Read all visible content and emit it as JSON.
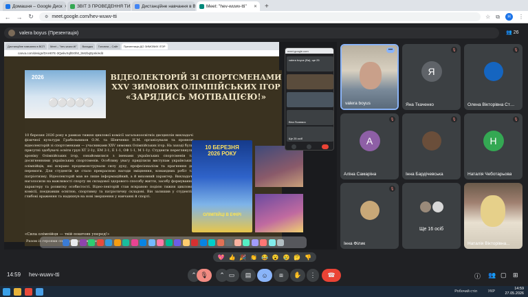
{
  "browser": {
    "tabs": [
      {
        "label": "Домашня – Google Диск",
        "color": "#1a73e8",
        "active": false
      },
      {
        "label": "ЗВІТ З ПРОВЕДЕННЯ ТИЖНЯ",
        "color": "#34a853",
        "active": false
      },
      {
        "label": "Дистанційне навчання в ВСП",
        "color": "#4285f4",
        "active": false
      },
      {
        "label": "Meet: \"hev-wuwv-tti\"",
        "color": "#00897b",
        "active": true
      }
    ],
    "new_tab": "+",
    "url": "meet.google.com/hev-wuwv-tti",
    "profile_letter": "Н"
  },
  "presenter": {
    "name": "valera boyus (Презентація)",
    "people_count": "26"
  },
  "shared_screen": {
    "inner_tabs": [
      "Chrome",
      "Файл",
      "Правка",
      "Вид",
      "Історія",
      "Закладки",
      "Профілі",
      "Вкладка",
      "Вікно",
      "Довідка"
    ],
    "inner_browser_tabs": [
      "Дистанційне навчання в ВСП",
      "Meet – \"hev-wuwv-tti\"",
      "Вкладка",
      "Головна – Сайт",
      "Презентація ДО ЗИМОВИХ ІГОР"
    ],
    "inner_url": "canva.com/design/DAHI0Tc-3QwkvXqfEI0h0_bMzbqDpnk/edit",
    "slide": {
      "badge_year": "2026",
      "rings": "⚪⚪⚪⚪⚪",
      "title_l1": "ВІДЕОЛЕКТОРІЙ ЗІ СПОРТСМЕНАМИ",
      "title_l2": "XXV ЗИМОВИХ ОЛІМПІЙСЬКИХ ІГОР",
      "title_l3": "«ЗАРЯДИСЬ МОТІВАЦІЄЮ!»",
      "body": "10 березня 2026 року в рамках тижня циклової комісії загальноосвітніх дисциплін викладачі фізичної культури Грабельников О.М. та Шевченко Н.М. організували та провели відеолекторій зі спортсменами — учасниками XXV зимових Олімпійських ігор. На заході були присутні здобувачі освіти груп ХТ 2-1у, ЕМ 2-1, Е 1-1, ОФ 1-1, М 1-1у. Студенти переглянули хроніку Олімпійських ігор, ознайомилися з іменами українських спортсменів та досягненнями українських спортсменів. Особливу увагу приділили виступам українських олімпійців, які яскраво продемонстрували силу духу, професіоналізм та прагнення до перемоги. Для студентів це стало прекрасною нагоди зміцнення, командних робіт та патріотизму. Відеолекторій мав не лише інформаційний, а й виховний характер. Викладачі наголосили на важливості спорту як складової здорового способу життя, засобу формування характеру та розвитку особистості. Відео-лекторій став яскравою подією тижня циклової комісії, поєднавши освітню, спортивну та патріотичну складові. Він залишив у студентів глибокі враження та надихнув на нові звершення у навчанні й спорті.",
      "quote1": "«Сила олімпійця — твій поштовх уперед!»",
      "quote2": "Разом із героями спорту — до нових висот",
      "poster_date": "10 БЕРЕЗНЯ 2026 РОКУ",
      "poster_title": "ОЛІМПІЙЦІ В ЕФІРІ"
    },
    "pip": {
      "url": "meet.google.com",
      "row1": "valera boyus (Ви), ще 25",
      "row2": "Віта Полевич",
      "row3": "Ще 25 осіб"
    }
  },
  "tiles": [
    {
      "name": "valera boyus",
      "type": "video",
      "muted": false,
      "more": true
    },
    {
      "name": "Яна Ткаченко",
      "type": "letter",
      "letter": "Я",
      "color": "#5f6368",
      "muted": true
    },
    {
      "name": "Олена Вікторівна Стр...",
      "type": "avatar",
      "color": "#1565c0",
      "muted": true
    },
    {
      "name": "Аліна Самаріна",
      "type": "letter",
      "letter": "А",
      "color": "#8e5fa6",
      "muted": true
    },
    {
      "name": "Інна Бардічевська",
      "type": "avatar",
      "color": "#6a4e3a",
      "muted": true
    },
    {
      "name": "Наталія Чеботарьова",
      "type": "letter",
      "letter": "Н",
      "color": "#34a853",
      "muted": true
    },
    {
      "name": "Інна Філик",
      "type": "avatar",
      "color": "#c8a878",
      "muted": true
    },
    {
      "name": "Ще 16 осіб",
      "type": "more"
    },
    {
      "name": "Наталія Вікторівна...",
      "type": "video2",
      "muted": false
    }
  ],
  "emojis": [
    "💖",
    "👍",
    "🎉",
    "👏",
    "😂",
    "😮",
    "😢",
    "🤔",
    "👎"
  ],
  "bottom": {
    "time": "14:59",
    "code": "hev-wuwv-tti",
    "more_icon": "more-vert-icon"
  },
  "taskbar": {
    "status": "Робочий стіл",
    "lang": "УКР",
    "clock": "14:59",
    "date": "27.05.2026"
  },
  "colors": {
    "meet_bg": "#202124",
    "tile_bg": "#3c4043",
    "hangup": "#ea4335",
    "accent": "#8ab4f8"
  }
}
